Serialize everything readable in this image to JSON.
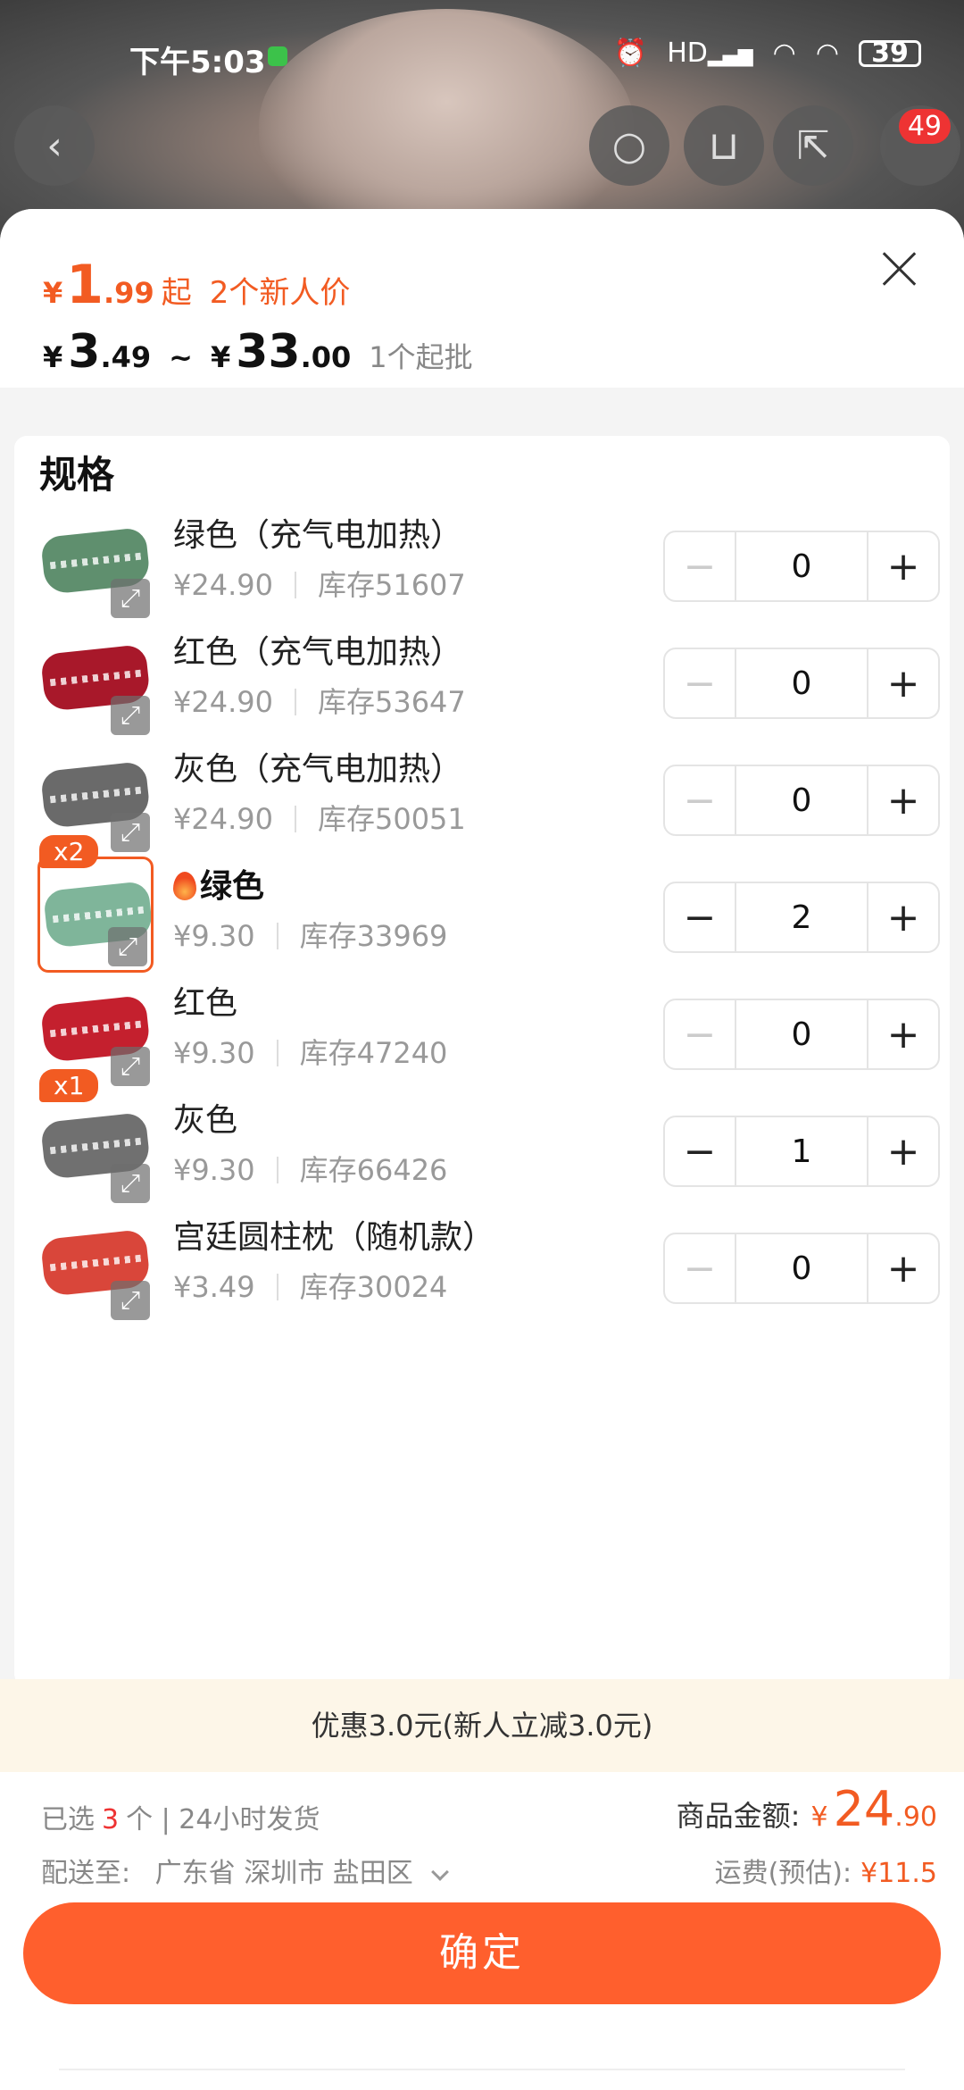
{
  "status_bar": {
    "time": "下午5:03",
    "network": "HD",
    "battery": "39"
  },
  "nav": {
    "cart_badge": "49"
  },
  "price": {
    "new_currency": "¥",
    "new_int": "1",
    "new_dec": ".99",
    "new_suffix": "起",
    "new_label": "2个新人价",
    "range_low_currency": "¥",
    "range_low_int": "3",
    "range_low_dec": ".49",
    "range_sep": "~",
    "range_high_currency": "¥",
    "range_high_int": "33",
    "range_high_dec": ".00",
    "moq": "1个起批"
  },
  "spec": {
    "title": "规格",
    "items": [
      {
        "name": "绿色（充气电加热）",
        "price": "¥24.90",
        "stock": "库存51607",
        "qty": "0",
        "color": "#5f8f6e",
        "hot": false,
        "badge": ""
      },
      {
        "name": "红色（充气电加热）",
        "price": "¥24.90",
        "stock": "库存53647",
        "qty": "0",
        "color": "#a8182a",
        "hot": false,
        "badge": ""
      },
      {
        "name": "灰色（充气电加热）",
        "price": "¥24.90",
        "stock": "库存50051",
        "qty": "0",
        "color": "#6a6a6a",
        "hot": false,
        "badge": ""
      },
      {
        "name": "绿色",
        "price": "¥9.30",
        "stock": "库存33969",
        "qty": "2",
        "color": "#7fb59a",
        "hot": true,
        "badge": "x2"
      },
      {
        "name": "红色",
        "price": "¥9.30",
        "stock": "库存47240",
        "qty": "0",
        "color": "#c4202e",
        "hot": false,
        "badge": ""
      },
      {
        "name": "灰色",
        "price": "¥9.30",
        "stock": "库存66426",
        "qty": "1",
        "color": "#707070",
        "hot": false,
        "badge": "x1"
      },
      {
        "name": "宫廷圆柱枕（随机款）",
        "price": "¥3.49",
        "stock": "库存30024",
        "qty": "0",
        "color": "#d9463a",
        "hot": false,
        "badge": ""
      }
    ],
    "minus": "−",
    "plus": "+"
  },
  "discount": "优惠3.0元(新人立减3.0元)",
  "footer": {
    "selected_prefix": "已选",
    "selected_count": "3",
    "selected_suffix": "个 | 24小时发货",
    "ship_to_label": "配送至:",
    "ship_to_value": "广东省 深圳市 盐田区",
    "amount_label": "商品金额:",
    "amount_currency": "¥",
    "amount_int": "24",
    "amount_dec": ".90",
    "freight_label": "运费(预估):",
    "freight_value": "¥11.5",
    "confirm": "确定"
  },
  "colors": {
    "accent": "#f25b22",
    "confirm_bg": "#ff5f2d"
  }
}
